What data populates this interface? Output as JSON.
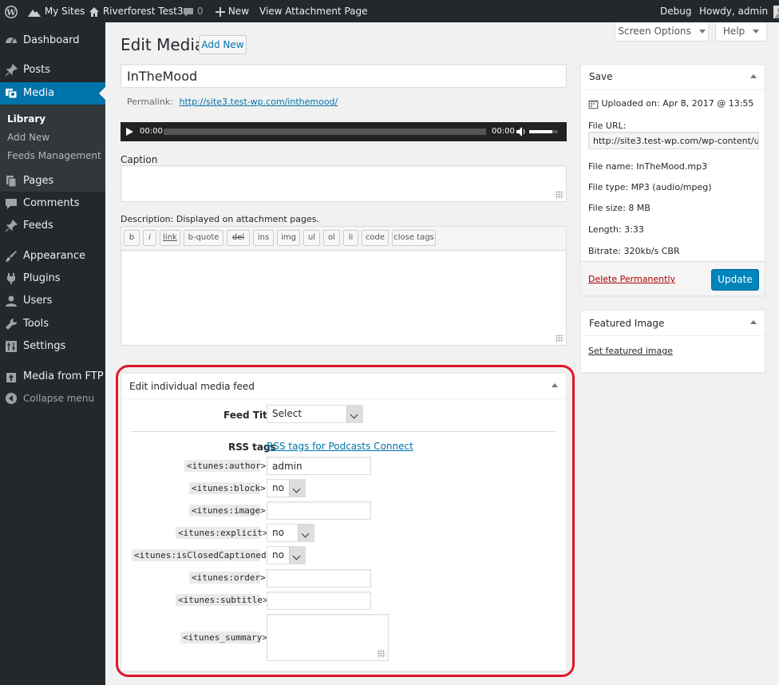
{
  "adminbar": {
    "my_sites": "My Sites",
    "site_name": "Riverforest Test3",
    "comments_count": "0",
    "new_label": "New",
    "view_attachment": "View Attachment Page",
    "debug": "Debug",
    "howdy": "Howdy, admin"
  },
  "sidebar": {
    "dashboard": "Dashboard",
    "posts": "Posts",
    "media": "Media",
    "library": "Library",
    "add_new": "Add New",
    "feeds_management": "Feeds Management",
    "pages": "Pages",
    "comments": "Comments",
    "feeds": "Feeds",
    "appearance": "Appearance",
    "plugins": "Plugins",
    "users": "Users",
    "tools": "Tools",
    "settings": "Settings",
    "media_from_ftp": "Media from FTP",
    "collapse_menu": "Collapse menu"
  },
  "header": {
    "title": "Edit Media",
    "add_new": "Add New",
    "screen_options": "Screen Options",
    "help": "Help"
  },
  "main": {
    "title_value": "InTheMood",
    "permalink_label": "Permalink:",
    "permalink_url": "http://site3.test-wp.com/inthemood/",
    "audio": {
      "current_time": "00:00",
      "duration": "00:00",
      "progress": 0,
      "volume": 0.8
    },
    "caption_label": "Caption",
    "description_label": "Description: Displayed on attachment pages.",
    "quicktags": [
      "b",
      "i",
      "link",
      "b-quote",
      "del",
      "ins",
      "img",
      "ul",
      "ol",
      "li",
      "code",
      "close tags"
    ]
  },
  "save_box": {
    "title": "Save",
    "uploaded_on": "Uploaded on: Apr 8, 2017 @ 13:55",
    "file_url_label": "File URL:",
    "file_url_value": "http://site3.test-wp.com/wp-content/u",
    "file_name": "File name: InTheMood.mp3",
    "file_type": "File type: MP3 (audio/mpeg)",
    "file_size": "File size: 8 MB",
    "length": "Length: 3:33",
    "bitrate": "Bitrate: 320kb/s CBR",
    "delete": "Delete Permanently",
    "update": "Update"
  },
  "featured_box": {
    "title": "Featured Image",
    "link": "Set featured image"
  },
  "feed_box": {
    "title": "Edit individual media feed",
    "feed_title_label": "Feed Title",
    "feed_title_value": "Select",
    "rss_tags_label": "RSS tags",
    "rss_tags_link": "RSS tags for Podcasts Connect",
    "author_label": "<itunes:author>",
    "author_value": "admin",
    "block_label": "<itunes:block>",
    "block_value": "no",
    "image_label": "<itunes:image>",
    "image_value": "",
    "explicit_label": "<itunes:explicit>",
    "explicit_value": "no",
    "closed_captioned_label": "<itunes:isClosedCaptioned>",
    "closed_captioned_value": "no",
    "order_label": "<itunes:order>",
    "order_value": "",
    "subtitle_label": "<itunes:subtitle>",
    "subtitle_value": "",
    "summary_label": "<itunes_summary>",
    "summary_value": ""
  },
  "colors": {
    "accent": "#0073aa",
    "highlight_border": "#e0162a",
    "sidebar_bg": "#23282d"
  }
}
